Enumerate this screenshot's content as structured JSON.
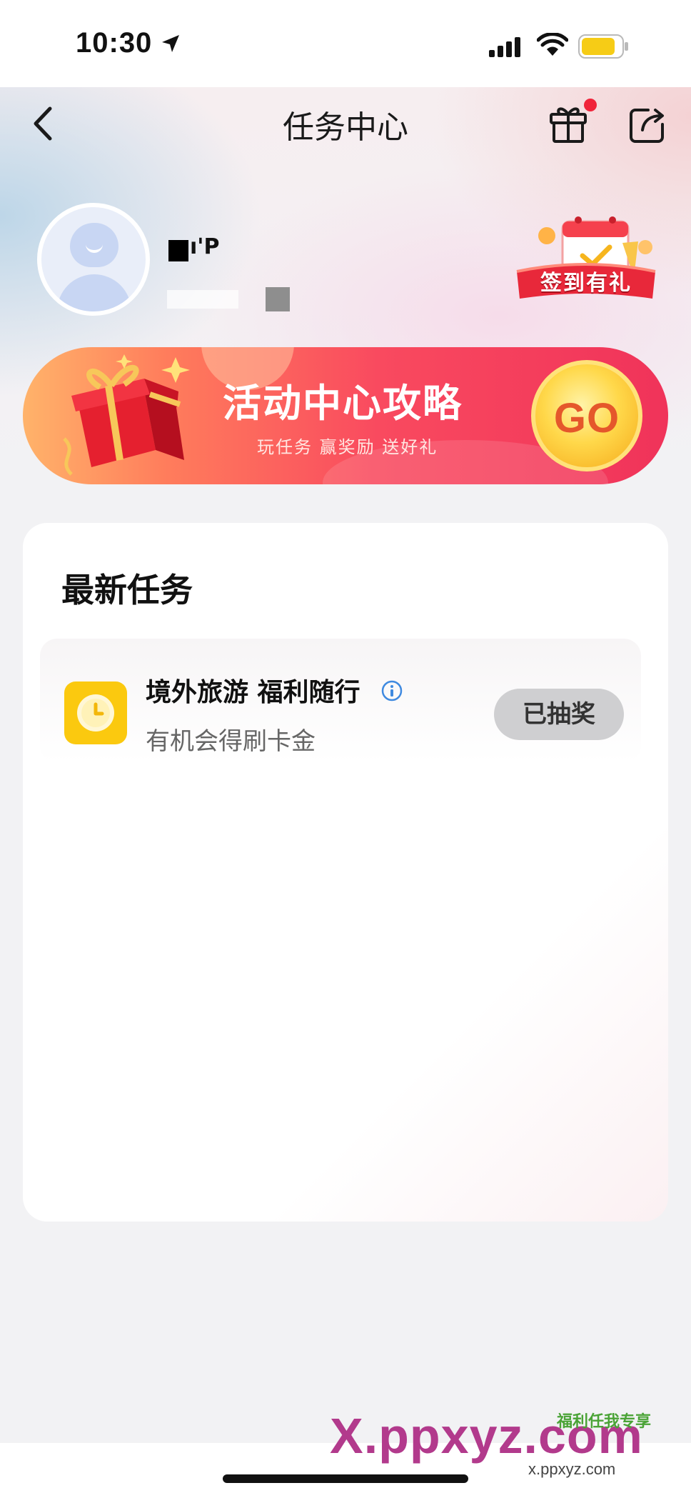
{
  "status_bar": {
    "time": "10:30"
  },
  "nav": {
    "title": "任务中心",
    "back_icon": "chevron-left-icon",
    "gift_icon": "gift-icon",
    "share_icon": "share-icon"
  },
  "profile": {
    "name_visible": "I▯",
    "checkin_label": "签到有礼"
  },
  "banner": {
    "title": "活动中心攻略",
    "subtitle": "玩任务 赢奖励 送好礼",
    "go_label": "GO"
  },
  "tasks": {
    "section_title": "最新任务",
    "items": [
      {
        "title": "境外旅游 福利随行",
        "description": "有机会得刷卡金",
        "status": "已抽奖",
        "icon": "clock-icon"
      }
    ]
  },
  "watermark": {
    "logo": "X.ppxyz.com",
    "sub": "x.ppxyz.com",
    "tag": "福利任我专享"
  },
  "colors": {
    "accent_red": "#f0335a",
    "task_icon_yellow": "#fbc90f",
    "status_grey": "#cfcfd1"
  }
}
